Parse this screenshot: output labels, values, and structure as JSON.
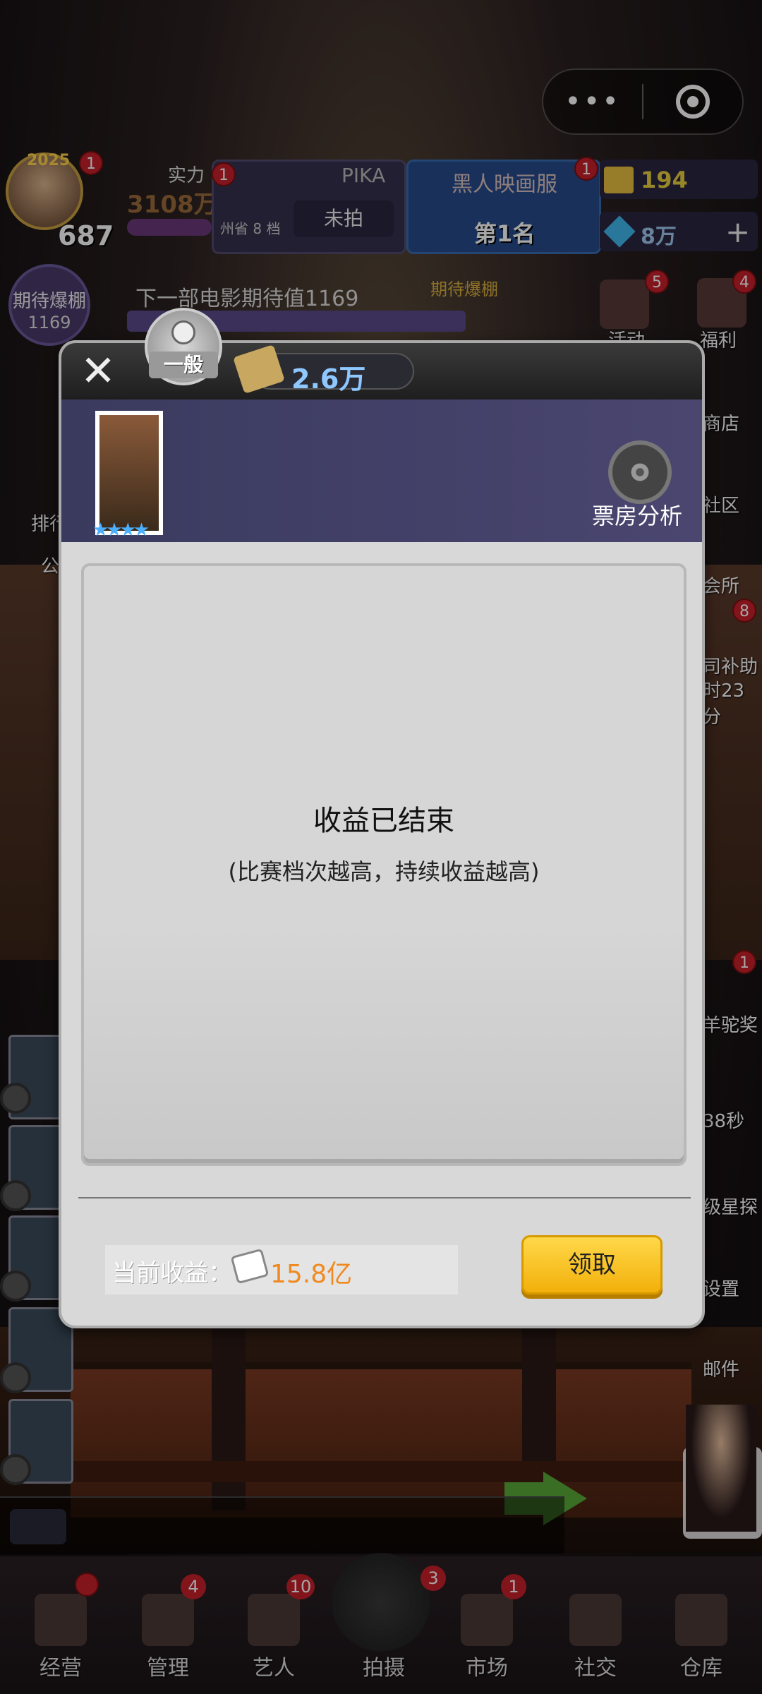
{
  "hud": {
    "level": "687",
    "year_badge": "2025",
    "avatar_badge": "1",
    "power_label": "实力",
    "power_value": "3108万",
    "pika_badge": "1",
    "pika_name": "PIKA",
    "pika_sub": "州省 8 档",
    "pika_button": "未拍",
    "cinema_badge": "1",
    "cinema_name": "黑人映画服",
    "cinema_rank": "第1名",
    "tickets": "194",
    "gems": "8万",
    "plus": "+"
  },
  "expect": {
    "circle_label": "期待爆棚",
    "circle_value": "1169",
    "bar_text": "下一部电影期待值1169",
    "bar_tag": "期待爆棚"
  },
  "side_right": [
    {
      "label": "活动",
      "badge": "5"
    },
    {
      "label": "福利",
      "badge": "4"
    },
    {
      "label": "商店",
      "badge": ""
    },
    {
      "label": "社区",
      "badge": ""
    },
    {
      "label": "会所",
      "badge": ""
    },
    {
      "label": "司补助",
      "badge": "8"
    },
    {
      "label": "时23分",
      "badge": ""
    },
    {
      "label": "羊驼奖",
      "badge": "1"
    },
    {
      "label": "38秒",
      "badge": ""
    },
    {
      "label": "级星探",
      "badge": ""
    },
    {
      "label": "设置",
      "badge": ""
    },
    {
      "label": "邮件",
      "badge": ""
    }
  ],
  "side_left": [
    {
      "label": "排行"
    },
    {
      "label": "公"
    }
  ],
  "modal": {
    "close": "✕",
    "rating": "一般",
    "money": "2.6万",
    "boxoffice_label": "票房分析",
    "poster_stars": "★★★★",
    "end_title": "收益已结束",
    "end_sub": "(比赛档次越高，持续收益越高)",
    "earn_label": "当前收益：",
    "earn_value": "15.8亿",
    "claim_button": "领取"
  },
  "nav": [
    {
      "label": "经营",
      "badge": ""
    },
    {
      "label": "管理",
      "badge": "4"
    },
    {
      "label": "艺人",
      "badge": "10"
    },
    {
      "label": "拍摄",
      "badge": "3"
    },
    {
      "label": "市场",
      "badge": "1"
    },
    {
      "label": "社交",
      "badge": ""
    },
    {
      "label": "仓库",
      "badge": ""
    }
  ],
  "capsule": {
    "more": "•••"
  }
}
